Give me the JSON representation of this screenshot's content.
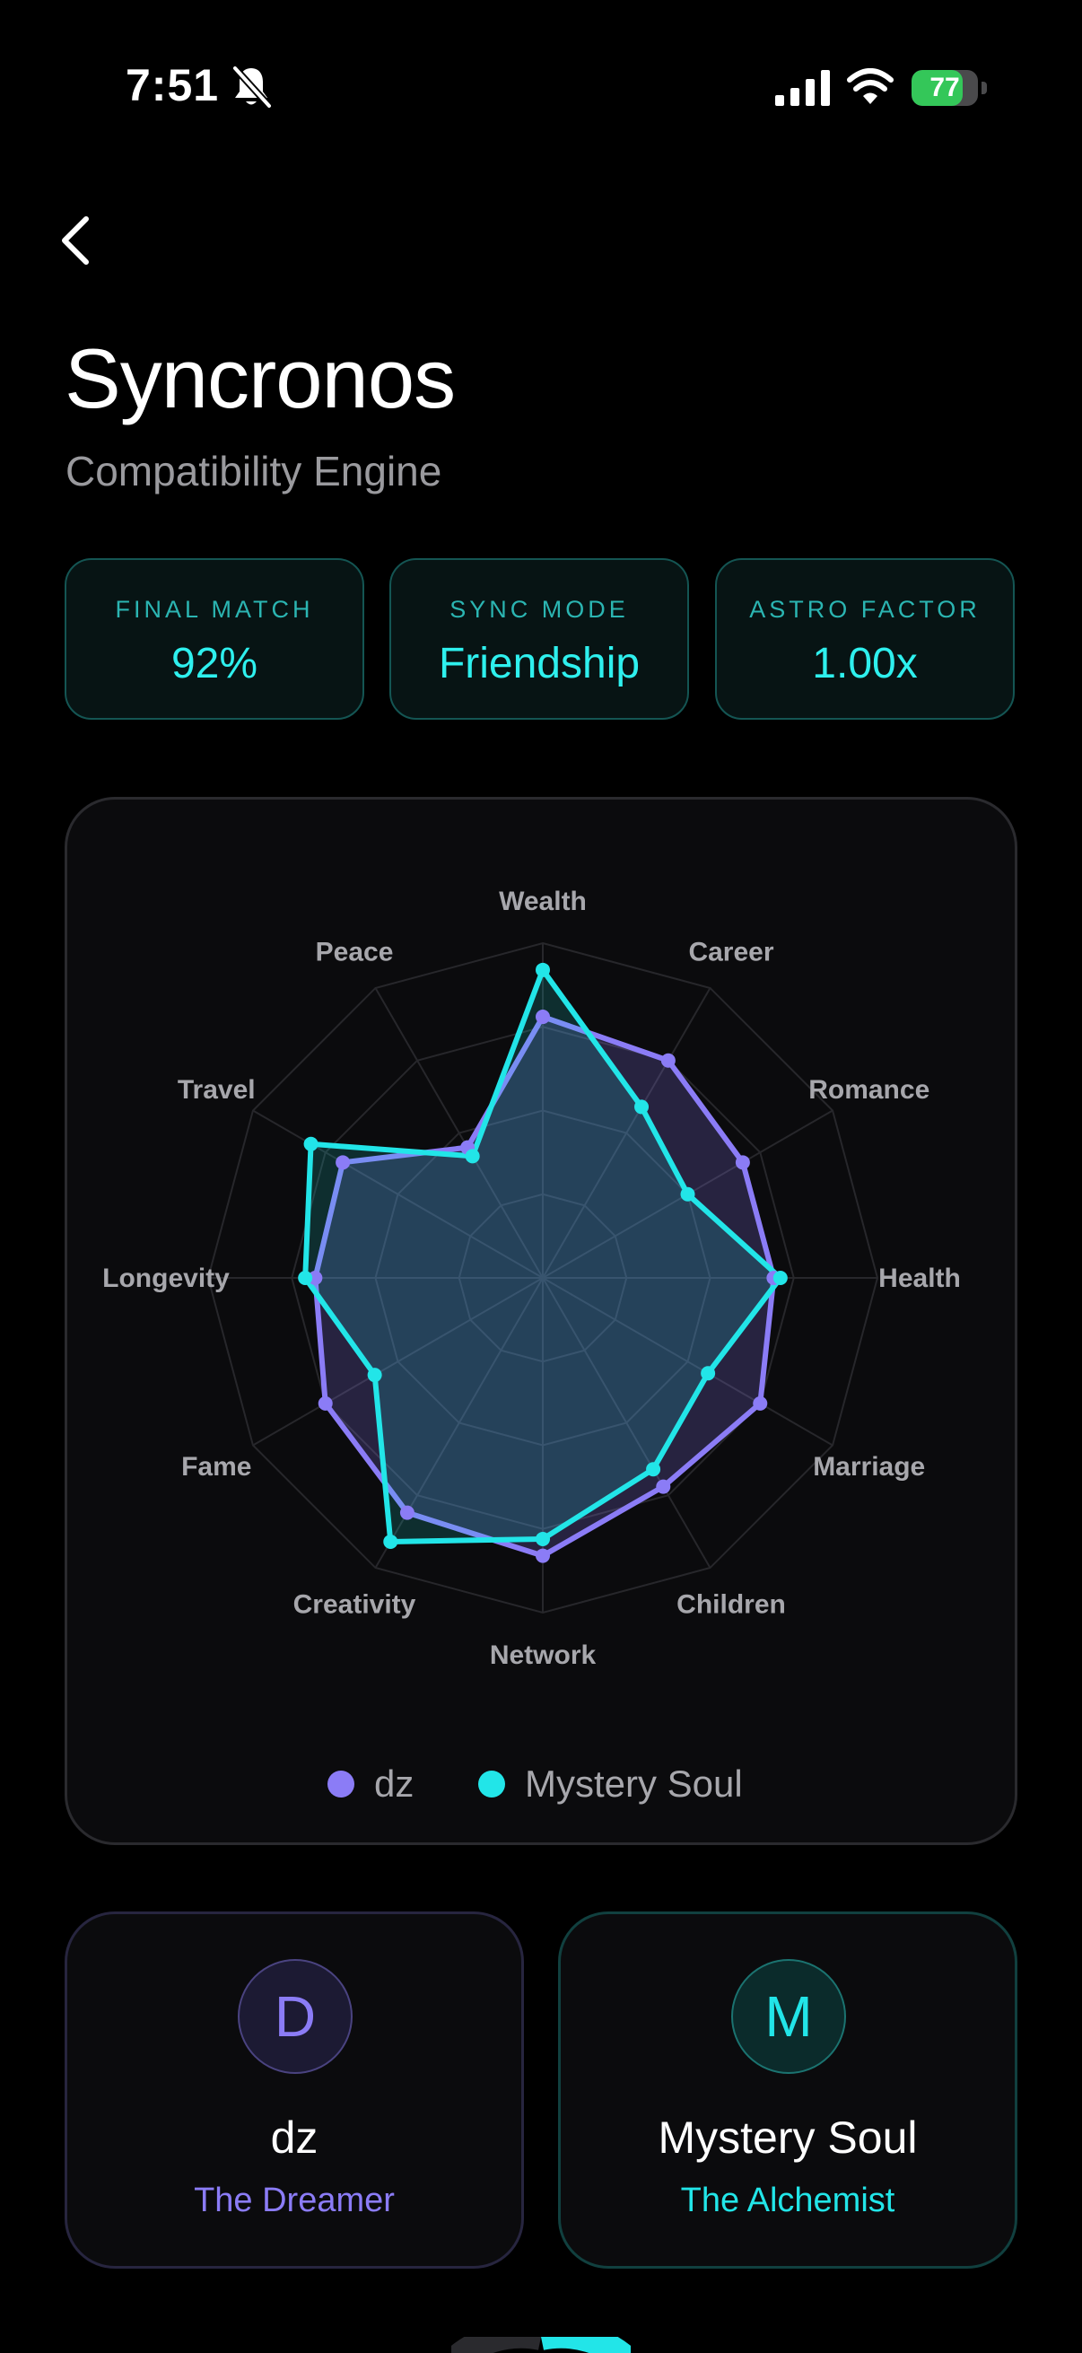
{
  "status_bar": {
    "time": "7:51",
    "battery_percent": 77,
    "battery_label": "77"
  },
  "header": {
    "title": "Syncronos",
    "subtitle": "Compatibility Engine"
  },
  "stats": [
    {
      "label": "FINAL MATCH",
      "value": "92%"
    },
    {
      "label": "SYNC MODE",
      "value": "Friendship"
    },
    {
      "label": "ASTRO FACTOR",
      "value": "1.00x"
    }
  ],
  "chart_data": {
    "type": "radar",
    "categories": [
      "Wealth",
      "Career",
      "Romance",
      "Health",
      "Marriage",
      "Children",
      "Network",
      "Creativity",
      "Fame",
      "Longevity",
      "Travel",
      "Peace"
    ],
    "max": 100,
    "series": [
      {
        "name": "dz",
        "color": "#8b7cf6",
        "values": [
          78,
          75,
          69,
          69,
          75,
          72,
          83,
          81,
          75,
          68,
          69,
          45
        ]
      },
      {
        "name": "Mystery Soul",
        "color": "#22e5e8",
        "values": [
          92,
          59,
          50,
          71,
          57,
          66,
          78,
          91,
          58,
          71,
          80,
          42
        ]
      }
    ]
  },
  "legend": {
    "dz": "dz",
    "mystery": "Mystery Soul"
  },
  "profiles": [
    {
      "initial": "D",
      "name": "dz",
      "role": "The Dreamer",
      "color": "#8b7cf6"
    },
    {
      "initial": "M",
      "name": "Mystery Soul",
      "role": "The Alchemist",
      "color": "#22e5e8"
    }
  ]
}
